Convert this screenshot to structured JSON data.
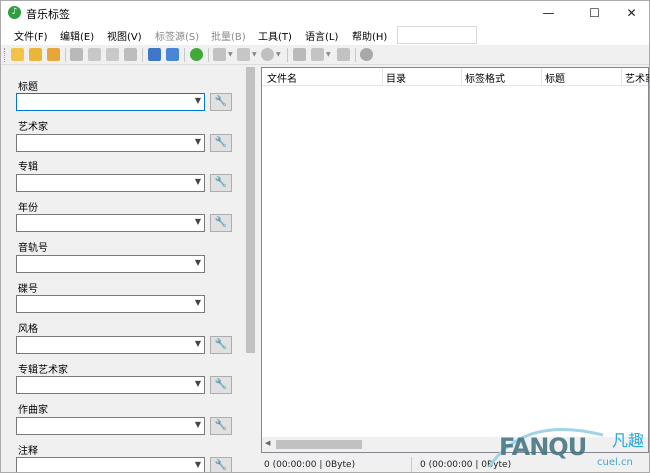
{
  "window": {
    "title": "音乐标签",
    "min": "—",
    "max": "☐",
    "close": "✕"
  },
  "menu": [
    {
      "label": "文件(F)"
    },
    {
      "label": "编辑(E)"
    },
    {
      "label": "视图(V)"
    },
    {
      "label": "标签源(S)",
      "disabled": true
    },
    {
      "label": "批量(B)",
      "disabled": true
    },
    {
      "label": "工具(T)"
    },
    {
      "label": "语言(L)"
    },
    {
      "label": "帮助(H)"
    }
  ],
  "toolbar": {
    "icons": [
      "open-folder-icon",
      "add-folder-icon",
      "open-files-icon",
      "save-icon",
      "delete-icon",
      "tag-book-icon",
      "wrench-icon",
      "grid-view-icon",
      "table-view-icon",
      "refresh-icon",
      "cover-icon",
      "tag-format-icon",
      "disc-icon",
      "magic-wand-icon",
      "copy-icon",
      "paste-icon",
      "settings-gear-icon"
    ]
  },
  "fields": [
    {
      "label": "标题",
      "value": "",
      "tool": "🔧"
    },
    {
      "label": "艺术家",
      "value": "",
      "tool": "🔧"
    },
    {
      "label": "专辑",
      "value": "",
      "tool": "🔧"
    },
    {
      "label": "年份",
      "value": "",
      "tool": "🔧"
    },
    {
      "label": "音轨号",
      "value": ""
    },
    {
      "label": "碟号",
      "value": ""
    },
    {
      "label": "风格",
      "value": "",
      "tool": "🔧"
    },
    {
      "label": "专辑艺术家",
      "value": "",
      "tool": "🔧"
    },
    {
      "label": "作曲家",
      "value": "",
      "tool": "🔧"
    },
    {
      "label": "注释",
      "value": "",
      "tool": "🔧"
    }
  ],
  "list": {
    "columns": [
      "文件名",
      "目录",
      "标签格式",
      "标题",
      "艺术家"
    ]
  },
  "status": {
    "left": "0 (00:00:00 | 0Byte)",
    "right": "0 (00:00:00 | 0Byte)"
  },
  "watermark": {
    "logo": "FANQU",
    "cn": "凡趣",
    "url": "cuel.cn"
  },
  "colors": {
    "accent_focus": "#0078d7",
    "app_icon": "#2e9e3e",
    "watermark": "#3aa9cf"
  }
}
